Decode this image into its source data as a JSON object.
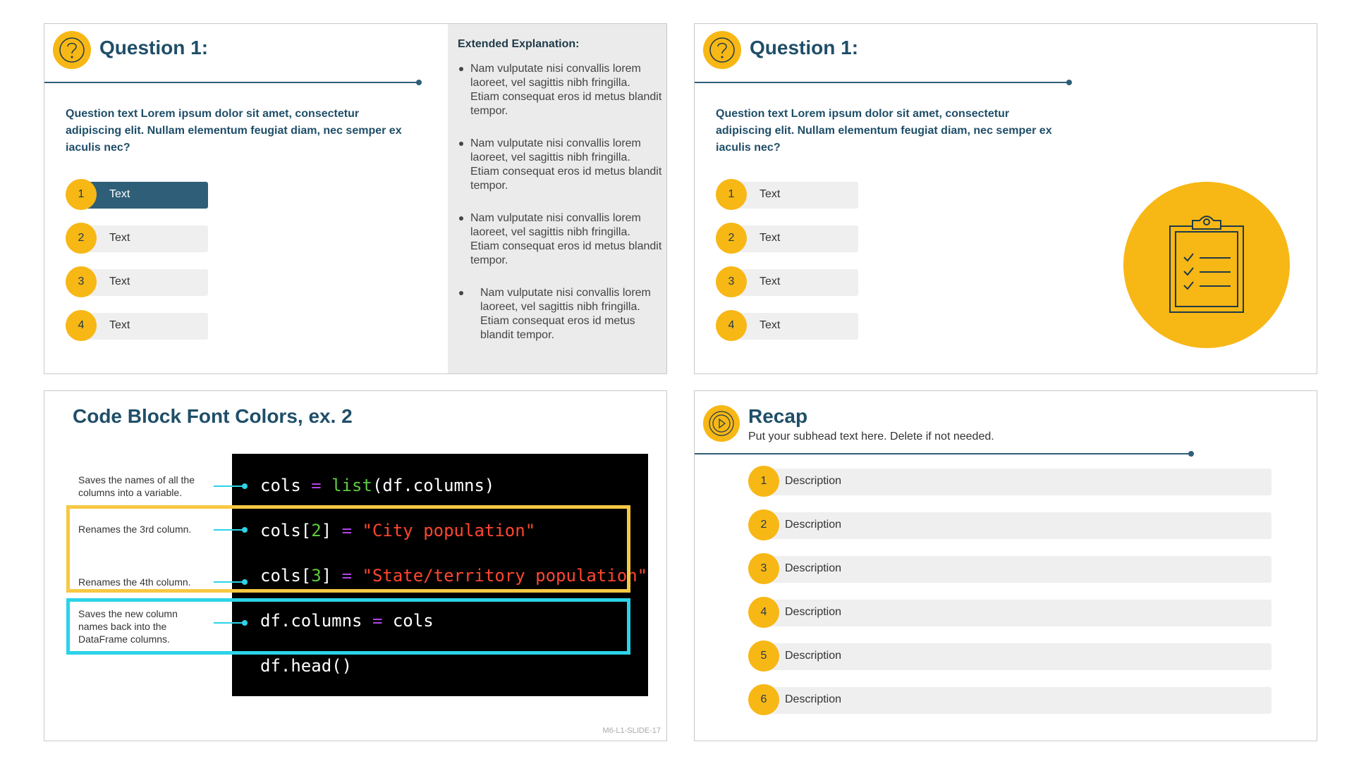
{
  "slide_question_a": {
    "title": "Question 1:",
    "question": "Question text Lorem ipsum dolor sit amet, consectetur adipiscing elit. Nullam elementum feugiat diam, nec semper ex iaculis nec?",
    "options": [
      {
        "num": "1",
        "label": "Text",
        "selected": true
      },
      {
        "num": "2",
        "label": "Text",
        "selected": false
      },
      {
        "num": "3",
        "label": "Text",
        "selected": false
      },
      {
        "num": "4",
        "label": "Text",
        "selected": false
      }
    ],
    "explanation_heading": "Extended Explanation:",
    "explanation_items": [
      "Nam vulputate nisi convallis lorem laoreet, vel sagittis nibh fringilla. Etiam consequat eros id metus blandit tempor.",
      "Nam vulputate nisi convallis lorem laoreet, vel sagittis nibh fringilla. Etiam consequat eros id metus blandit tempor.",
      "Nam vulputate nisi convallis lorem laoreet, vel sagittis nibh fringilla. Etiam consequat eros id metus blandit tempor.",
      "Nam vulputate nisi convallis lorem laoreet, vel sagittis nibh fringilla. Etiam consequat eros id metus blandit tempor."
    ]
  },
  "slide_question_b": {
    "title": "Question 1:",
    "question": "Question text Lorem ipsum dolor sit amet, consectetur adipiscing elit. Nullam elementum feugiat diam, nec semper ex iaculis nec?",
    "options": [
      {
        "num": "1",
        "label": "Text"
      },
      {
        "num": "2",
        "label": "Text"
      },
      {
        "num": "3",
        "label": "Text"
      },
      {
        "num": "4",
        "label": "Text"
      }
    ],
    "illustration_icon": "clipboard-checklist-icon"
  },
  "slide_code": {
    "title": "Code Block Font Colors, ex. 2",
    "annotations": [
      "Saves the names of all the columns into a variable.",
      "Renames the 3rd column.",
      "Renames the 4th column.",
      "Saves the new column names back into the DataFrame columns."
    ],
    "code_lines": {
      "l1_a": "cols ",
      "l1_eq": "=",
      "l1_fn": " list",
      "l1_b": "(df.columns)",
      "l2_a": "cols[",
      "l2_num": "2",
      "l2_b": "] ",
      "l2_eq": "=",
      "l2_str": " \"City population\"",
      "l3_a": "cols[",
      "l3_num": "3",
      "l3_b": "] ",
      "l3_eq": "=",
      "l3_str": " \"State/territory population\"",
      "l4_a": "df.columns ",
      "l4_eq": "=",
      "l4_b": " cols",
      "l5": "df.head()"
    },
    "slide_id": "M6-L1-SLIDE-17",
    "colors": {
      "highlight_yellow": "#f7c843",
      "highlight_cyan": "#2bd3e8",
      "code_string": "#ff4630",
      "code_function": "#5ecb3f",
      "code_operator": "#b045e6"
    }
  },
  "slide_recap": {
    "title": "Recap",
    "subhead": "Put your subhead text here. Delete if not needed.",
    "items": [
      {
        "num": "1",
        "label": "Description"
      },
      {
        "num": "2",
        "label": "Description"
      },
      {
        "num": "3",
        "label": "Description"
      },
      {
        "num": "4",
        "label": "Description"
      },
      {
        "num": "5",
        "label": "Description"
      },
      {
        "num": "6",
        "label": "Description"
      }
    ]
  }
}
